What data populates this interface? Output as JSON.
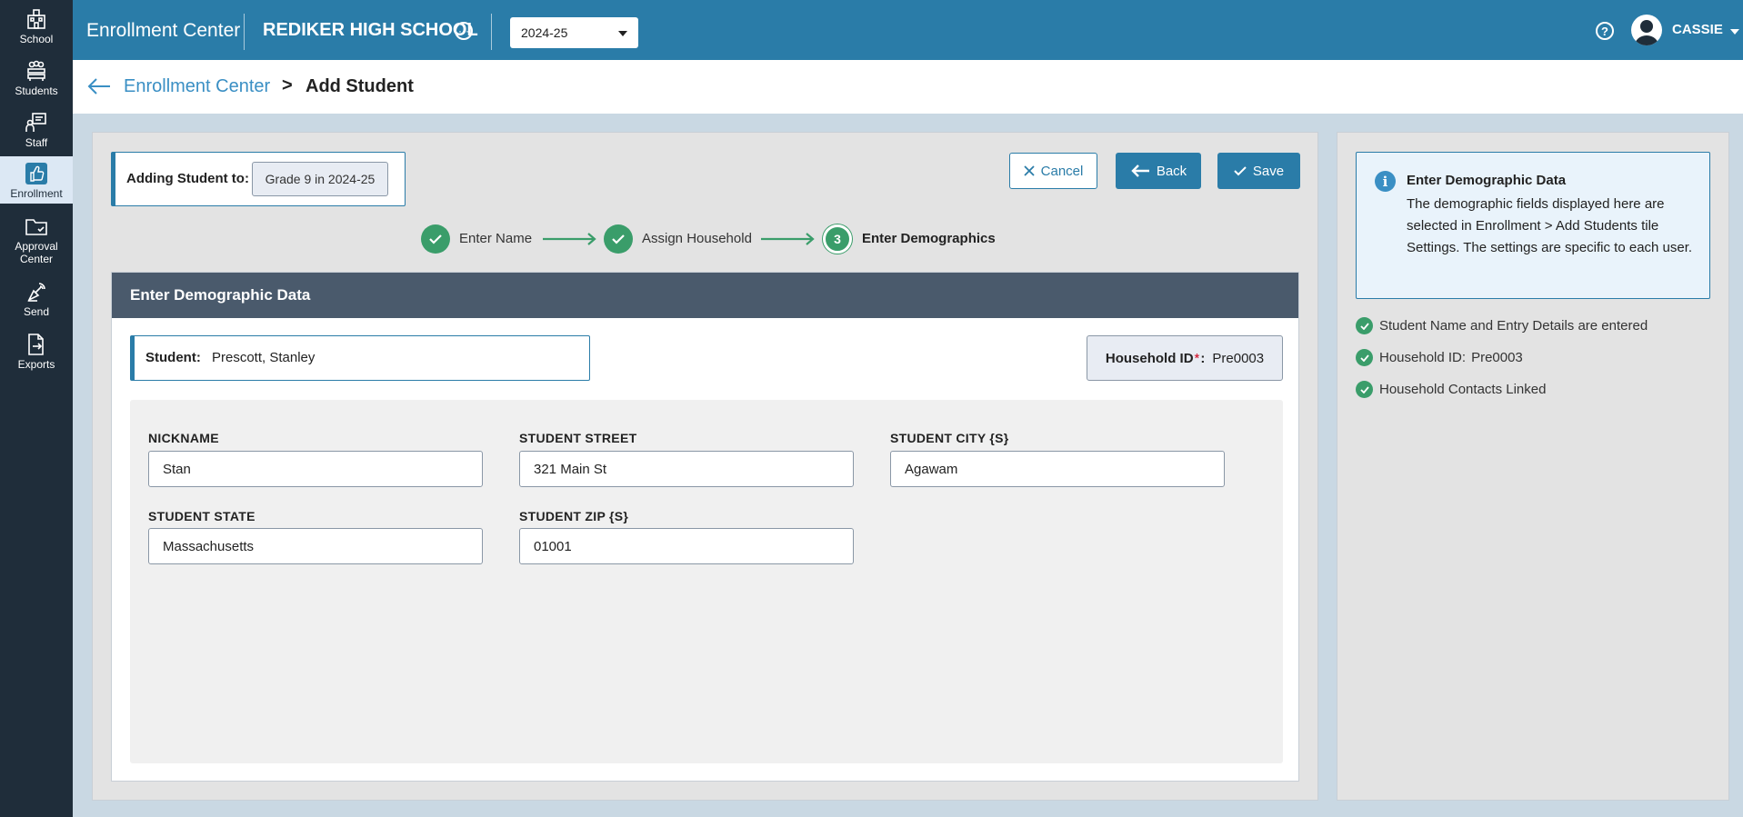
{
  "sidebar": {
    "items": [
      {
        "label": "School"
      },
      {
        "label": "Students"
      },
      {
        "label": "Staff"
      },
      {
        "label": "Enrollment"
      },
      {
        "label": "Approval Center"
      },
      {
        "label": "Send"
      },
      {
        "label": "Exports"
      }
    ],
    "active": "Enrollment"
  },
  "topbar": {
    "app_title": "Enrollment Center",
    "school_name": "REDIKER HIGH SCHOOL",
    "year": "2024-25",
    "user": "CASSIE"
  },
  "breadcrumb": {
    "parent": "Enrollment Center",
    "separator": ">",
    "current": "Add Student"
  },
  "adding": {
    "label": "Adding Student to:",
    "target": "Grade 9 in 2024-25"
  },
  "buttons": {
    "cancel": "Cancel",
    "back": "Back",
    "save": "Save"
  },
  "stepper": {
    "steps": [
      {
        "label": "Enter Name",
        "status": "done"
      },
      {
        "label": "Assign Household",
        "status": "done"
      },
      {
        "label": "Enter Demographics",
        "status": "current",
        "number": "3"
      }
    ]
  },
  "card": {
    "title": "Enter Demographic Data",
    "student_label": "Student:",
    "student_value": "Prescott, Stanley",
    "household_label": "Household ID",
    "household_required": "*",
    "household_colon": ":",
    "household_value": "Pre0003"
  },
  "fields": [
    {
      "label": "NICKNAME",
      "value": "Stan"
    },
    {
      "label": "STUDENT STREET",
      "value": "321 Main St"
    },
    {
      "label": "STUDENT CITY {S}",
      "value": "Agawam"
    },
    {
      "label": "STUDENT STATE",
      "value": "Massachusetts"
    },
    {
      "label": "STUDENT ZIP {S}",
      "value": "01001"
    }
  ],
  "info": {
    "title": "Enter Demographic Data",
    "text": "The demographic fields displayed here are selected in Enrollment > Add Students tile Settings. The settings are specific to each user."
  },
  "checklist": [
    {
      "label": "Student Name and Entry Details are entered",
      "value": ""
    },
    {
      "label": "Household ID:",
      "value": "Pre0003"
    },
    {
      "label": "Household Contacts Linked",
      "value": ""
    }
  ],
  "colors": {
    "topbar": "#2a7ca8",
    "sidebar": "#1f2d3a",
    "success": "#3a9d6a",
    "card_header": "#4a5a6c",
    "link": "#3a8fc4"
  }
}
